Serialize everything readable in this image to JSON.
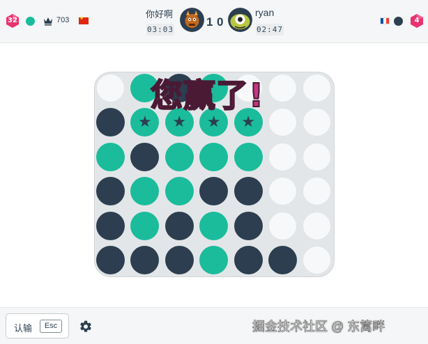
{
  "player": {
    "level": "32",
    "rating": "703",
    "name": "你好啊",
    "clock": "03:03",
    "score": "1"
  },
  "opponent": {
    "level": "4",
    "name": "ryan",
    "clock": "02:47",
    "score": "0"
  },
  "board": {
    "rows": [
      [
        "empty",
        "teal",
        "dark",
        "teal",
        "empty",
        "empty",
        "empty"
      ],
      [
        "dark",
        "teal-star",
        "teal-star",
        "teal-star",
        "teal-star",
        "empty",
        "empty"
      ],
      [
        "teal",
        "dark",
        "teal",
        "teal",
        "teal",
        "empty",
        "empty"
      ],
      [
        "dark",
        "teal",
        "teal",
        "dark",
        "dark",
        "empty",
        "empty"
      ],
      [
        "dark",
        "teal",
        "dark",
        "teal",
        "dark",
        "empty",
        "empty"
      ],
      [
        "dark",
        "dark",
        "dark",
        "teal",
        "dark",
        "dark",
        "empty"
      ]
    ]
  },
  "result": {
    "message": "您赢了!"
  },
  "footer": {
    "resign_label": "认输",
    "resign_shortcut": "Esc",
    "watermark": "掘金技术社区 @ 东篱畔"
  },
  "colors": {
    "player_piece": "#1abc9c",
    "opponent_piece": "#2c3e50",
    "level_badge": "#e8336d",
    "win_text": "#c2387e"
  },
  "icons": {
    "crown": "crown-icon",
    "settings": "gear-icon"
  }
}
